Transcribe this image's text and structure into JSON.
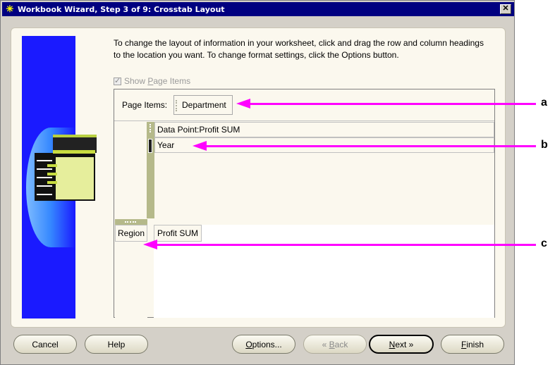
{
  "window": {
    "title": "Workbook Wizard, Step 3 of 9: Crosstab Layout",
    "close_glyph": "✕"
  },
  "instructions": {
    "line1": "To change the layout of information in your worksheet, click and drag the row and column headings",
    "line2": "to the location you want.  To change format settings, click the Options button."
  },
  "show_page_items": {
    "prefix": "Show ",
    "mnemonic": "P",
    "suffix": "age Items",
    "checked": true,
    "enabled": false
  },
  "page_items": {
    "label": "Page Items:",
    "items": [
      "Department"
    ]
  },
  "columns": {
    "items": [
      "Data Point:Profit SUM",
      "Year"
    ]
  },
  "rows": {
    "items": [
      "Region"
    ]
  },
  "data": {
    "header": "Profit SUM"
  },
  "buttons": {
    "cancel": "Cancel",
    "help": "Help",
    "options_mn": "O",
    "options_rest": "ptions...",
    "back_glyph": "«",
    "back_mn": "B",
    "back_rest": "ack",
    "next_mn": "N",
    "next_rest": "ext",
    "next_glyph": "»",
    "finish_mn": "F",
    "finish_rest": "inish"
  },
  "callouts": {
    "a": "a",
    "b": "b",
    "c": "c"
  },
  "colors": {
    "title_bar": "#000080",
    "annotation": "#ff00ff",
    "panel": "#fbf8ee",
    "handle": "#b5b98a"
  }
}
